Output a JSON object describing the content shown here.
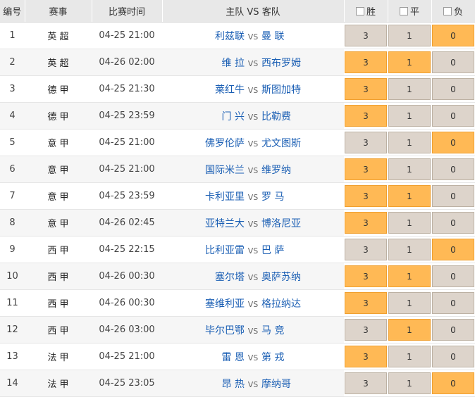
{
  "header": {
    "num": "编号",
    "league": "赛事",
    "time": "比赛时间",
    "match": "主队 VS 客队",
    "win": "胜",
    "draw": "平",
    "lose": "负"
  },
  "colors": {
    "selected": "#ffb955",
    "unselected": "#ddd4cb",
    "team_link": "#1b5fb4"
  },
  "rows": [
    {
      "num": "1",
      "league": "英 超",
      "time": "04-25 21:00",
      "home": "利兹联",
      "vs": "VS",
      "away": "曼 联",
      "odds": [
        "3",
        "1",
        "0"
      ],
      "selected": [
        false,
        false,
        true
      ]
    },
    {
      "num": "2",
      "league": "英 超",
      "time": "04-26 02:00",
      "home": "维 拉",
      "vs": "VS",
      "away": "西布罗姆",
      "odds": [
        "3",
        "1",
        "0"
      ],
      "selected": [
        true,
        true,
        false
      ]
    },
    {
      "num": "3",
      "league": "德 甲",
      "time": "04-25 21:30",
      "home": "莱红牛",
      "vs": "VS",
      "away": "斯图加特",
      "odds": [
        "3",
        "1",
        "0"
      ],
      "selected": [
        true,
        false,
        false
      ]
    },
    {
      "num": "4",
      "league": "德 甲",
      "time": "04-25 23:59",
      "home": "门 兴",
      "vs": "VS",
      "away": "比勒费",
      "odds": [
        "3",
        "1",
        "0"
      ],
      "selected": [
        true,
        false,
        false
      ]
    },
    {
      "num": "5",
      "league": "意 甲",
      "time": "04-25 21:00",
      "home": "佛罗伦萨",
      "vs": "VS",
      "away": "尤文图斯",
      "odds": [
        "3",
        "1",
        "0"
      ],
      "selected": [
        false,
        false,
        true
      ]
    },
    {
      "num": "6",
      "league": "意 甲",
      "time": "04-25 21:00",
      "home": "国际米兰",
      "vs": "VS",
      "away": "维罗纳",
      "odds": [
        "3",
        "1",
        "0"
      ],
      "selected": [
        true,
        false,
        false
      ]
    },
    {
      "num": "7",
      "league": "意 甲",
      "time": "04-25 23:59",
      "home": "卡利亚里",
      "vs": "VS",
      "away": "罗 马",
      "odds": [
        "3",
        "1",
        "0"
      ],
      "selected": [
        true,
        true,
        false
      ]
    },
    {
      "num": "8",
      "league": "意 甲",
      "time": "04-26 02:45",
      "home": "亚特兰大",
      "vs": "VS",
      "away": "博洛尼亚",
      "odds": [
        "3",
        "1",
        "0"
      ],
      "selected": [
        true,
        false,
        false
      ]
    },
    {
      "num": "9",
      "league": "西 甲",
      "time": "04-25 22:15",
      "home": "比利亚雷",
      "vs": "VS",
      "away": "巴 萨",
      "odds": [
        "3",
        "1",
        "0"
      ],
      "selected": [
        false,
        false,
        true
      ]
    },
    {
      "num": "10",
      "league": "西 甲",
      "time": "04-26 00:30",
      "home": "塞尔塔",
      "vs": "VS",
      "away": "奥萨苏纳",
      "odds": [
        "3",
        "1",
        "0"
      ],
      "selected": [
        true,
        true,
        false
      ]
    },
    {
      "num": "11",
      "league": "西 甲",
      "time": "04-26 00:30",
      "home": "塞维利亚",
      "vs": "VS",
      "away": "格拉纳达",
      "odds": [
        "3",
        "1",
        "0"
      ],
      "selected": [
        true,
        false,
        false
      ]
    },
    {
      "num": "12",
      "league": "西 甲",
      "time": "04-26 03:00",
      "home": "毕尔巴鄂",
      "vs": "VS",
      "away": "马 竞",
      "odds": [
        "3",
        "1",
        "0"
      ],
      "selected": [
        false,
        true,
        false
      ]
    },
    {
      "num": "13",
      "league": "法 甲",
      "time": "04-25 21:00",
      "home": "雷 恩",
      "vs": "VS",
      "away": "第 戎",
      "odds": [
        "3",
        "1",
        "0"
      ],
      "selected": [
        true,
        false,
        false
      ]
    },
    {
      "num": "14",
      "league": "法 甲",
      "time": "04-25 23:05",
      "home": "昂 热",
      "vs": "VS",
      "away": "摩纳哥",
      "odds": [
        "3",
        "1",
        "0"
      ],
      "selected": [
        false,
        false,
        true
      ]
    }
  ]
}
